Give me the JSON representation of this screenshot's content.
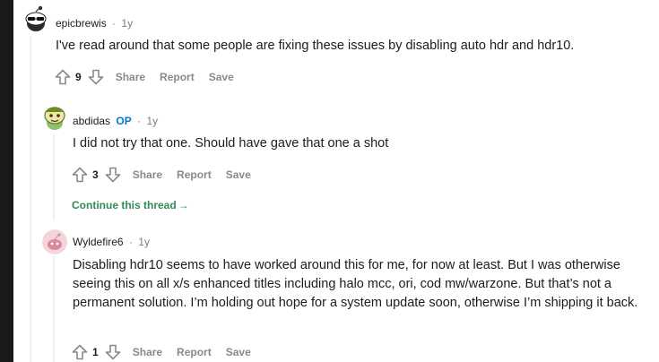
{
  "comments": [
    {
      "username": "epicbrewis",
      "op_badge": "",
      "age": "1y",
      "body": "I've read around that some people are fixing these issues by disabling auto hdr and hdr10.",
      "score": "9",
      "actions": [
        "Share",
        "Report",
        "Save"
      ]
    },
    {
      "username": "abdidas",
      "op_badge": "OP",
      "age": "1y",
      "body": "I did not try that one. Should have gave that one a shot",
      "score": "3",
      "actions": [
        "Share",
        "Report",
        "Save"
      ]
    },
    {
      "username": "Wyldefire6",
      "op_badge": "",
      "age": "1y",
      "body": "Disabling hdr10 seems to have worked around this for me, for now at least. But I was otherwise seeing this on all x/s enhanced titles including halo mcc, ori, cod mw/warzone. But that’s not a permanent solution. I’m holding out hope for a system update soon, otherwise I’m shipping it back.",
      "score": "1",
      "actions": [
        "Share",
        "Report",
        "Save"
      ]
    }
  ],
  "continue_thread": "Continue this thread",
  "separator": "·",
  "colors": {
    "op": "#0079d3",
    "continue": "#2e8b57",
    "action_gray": "#878a8c",
    "thread_line": "#edeff1"
  },
  "icons": {
    "upvote": "arrow-up-outline",
    "downvote": "arrow-down-outline"
  }
}
